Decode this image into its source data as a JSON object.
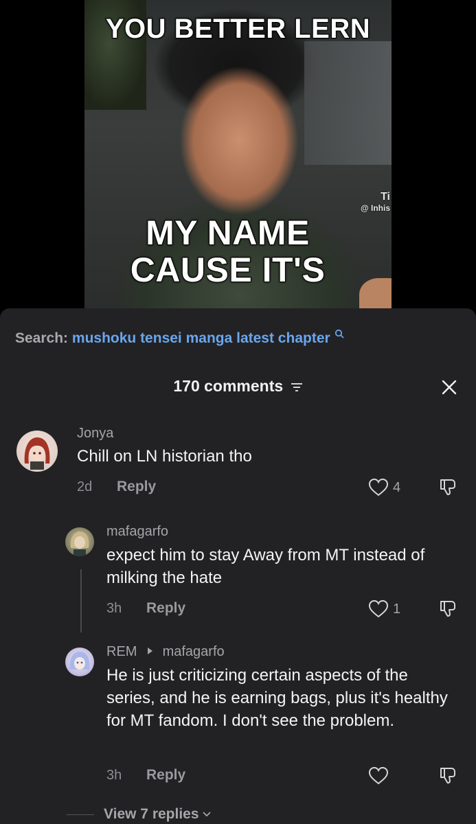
{
  "video": {
    "meme_top": "YOU BETTER LERN",
    "meme_bottom_line1": "MY NAME",
    "meme_bottom_line2": "CAUSE IT'S",
    "watermark_line1": "Ti",
    "watermark_line2": "@ Inhis"
  },
  "search": {
    "prefix": "Search:",
    "query": "mushoku tensei manga latest chapter"
  },
  "header": {
    "comment_count": "170 comments"
  },
  "comments": [
    {
      "username": "Jonya",
      "text": "Chill on LN historian tho",
      "age": "2d",
      "reply_label": "Reply",
      "likes": "4"
    },
    {
      "username": "mafagarfo",
      "text": "expect him to stay Away from MT instead of milking the hate",
      "age": "3h",
      "reply_label": "Reply",
      "likes": "1"
    },
    {
      "username": "REM",
      "reply_to": "mafagarfo",
      "text": "He is just criticizing certain aspects of the series, and he is earning bags, plus it's healthy for MT fandom. I don't see the problem.",
      "age": "3h",
      "reply_label": "Reply",
      "likes": ""
    }
  ],
  "view_replies": "View 7 replies",
  "colors": {
    "sheet_bg": "#222224",
    "search_query": "#6aa6ee",
    "muted_text": "#a6a6aa"
  }
}
